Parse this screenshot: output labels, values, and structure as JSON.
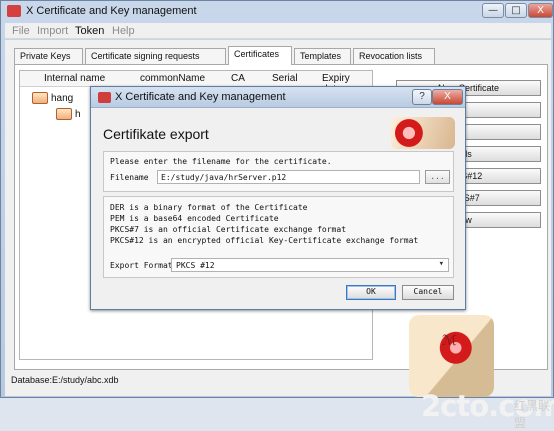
{
  "window": {
    "title": "X Certificate and Key management",
    "controls": [
      "—",
      "□",
      "X"
    ]
  },
  "menu": [
    "File",
    "Import",
    "Token",
    "Help"
  ],
  "tabs": [
    "Private Keys",
    "Certificate signing requests",
    "Certificates",
    "Templates",
    "Revocation lists"
  ],
  "columns": [
    "Internal name",
    "commonName",
    "CA",
    "Serial",
    "Expiry date"
  ],
  "rows": [
    "hang",
    "h"
  ],
  "side_buttons": [
    "New Certificate",
    "",
    "",
    "ls",
    "CS#12",
    "CS#7",
    "w"
  ],
  "status": "Database:E:/study/abc.xdb",
  "watermark": {
    "text": "2cto.com",
    "sub": "红黑联盟"
  },
  "dialog": {
    "title": "X Certificate and Key management",
    "heading": "Certifikate export",
    "prompt": "Please enter the filename for the certificate.",
    "filename_label": "Filename",
    "filename_value": "E:/study/java/hrServer.p12",
    "browse_label": "...",
    "info_lines": [
      "DER is a binary format of the Certificate",
      "PEM is a base64 encoded Certificate",
      "PKCS#7 is an official Certificate exchange format",
      "PKCS#12 is an encrypted official Key-Certificate exchange format"
    ],
    "format_label": "Export Format",
    "format_value": "PKCS #12",
    "ok": "OK",
    "cancel": "Cancel",
    "help": "?",
    "close": "X"
  }
}
